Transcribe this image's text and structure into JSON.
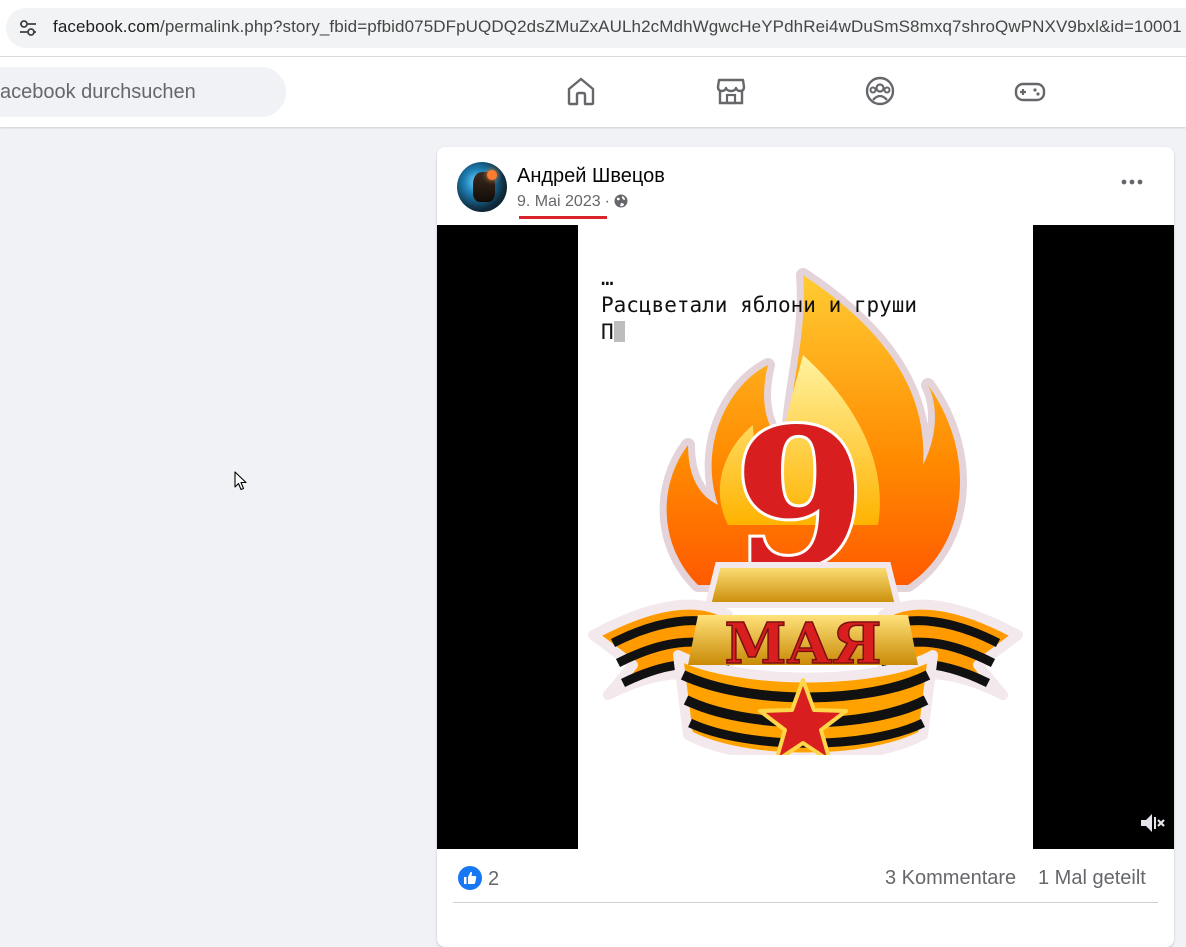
{
  "browser": {
    "url_host": "facebook.com",
    "url_path": "/permalink.php?story_fbid=pfbid075DFpUQDQ2dsZMuZxAULh2cMdhWgwcHeYPdhRei4wDuSmS8mxq7shroQwPNXV9bxl&id=10001"
  },
  "topbar": {
    "search_placeholder": "acebook durchsuchen",
    "nav": [
      "home-icon",
      "marketplace-icon",
      "groups-icon",
      "gaming-icon"
    ]
  },
  "post": {
    "author": "Андрей Швецов",
    "date": "9. Mai 2023",
    "separator": "·",
    "privacy_icon": "globe-icon",
    "video": {
      "lyric_line1": "…",
      "lyric_line2": "Расцветали яблони и груши",
      "lyric_line3": "П",
      "emblem_number": "9",
      "emblem_word": "МАЯ"
    },
    "stats": {
      "like_count": "2",
      "comments": "3 Kommentare",
      "shares": "1 Mal geteilt"
    }
  },
  "colors": {
    "fb_blue": "#1877f2",
    "annotation_red": "#d9232d"
  }
}
